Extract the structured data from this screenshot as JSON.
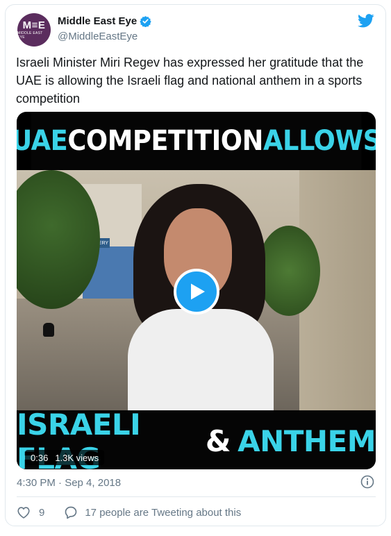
{
  "account": {
    "avatar_text": "M≡E",
    "avatar_sub": "MIDDLE EAST EYE",
    "name": "Middle East Eye",
    "handle": "@MiddleEastEye"
  },
  "tweet": {
    "text": "Israeli Minister Miri Regev has expressed her gratitude that the UAE is allowing the Israeli flag and national anthem in a sports competition",
    "timestamp": "4:30 PM · Sep 4, 2018"
  },
  "video": {
    "banner_top": {
      "word1": "UAE",
      "word2": "COMPETITION",
      "word3": "ALLOWS"
    },
    "banner_bottom": {
      "word1": "ISRAELI FLAG",
      "word2": "&",
      "word3": "ANTHEM"
    },
    "scene_sign": "GALLERY",
    "duration": "0:36",
    "views": "1.3K views"
  },
  "engagement": {
    "likes": "9",
    "tweeting": "17 people are Tweeting about this"
  },
  "colors": {
    "twitter_blue": "#1da1f2",
    "banner_cyan": "#3ad3e8",
    "secondary_text": "#657786",
    "avatar_bg": "#5b2d5e"
  },
  "icons": [
    "verified-badge-icon",
    "twitter-bird-icon",
    "play-icon",
    "info-icon",
    "heart-icon",
    "reply-bubble-icon"
  ]
}
